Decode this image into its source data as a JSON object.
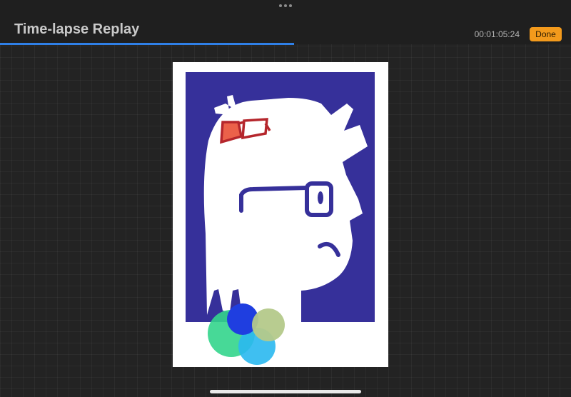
{
  "header": {
    "title": "Time-lapse Replay",
    "timestamp": "00:01:05:24",
    "done_label": "Done",
    "more_icon": "ellipsis-icon"
  },
  "replay": {
    "progress_percent": 51.5,
    "progress_color": "#2f80e8"
  },
  "colors": {
    "accent": "#f39a1c",
    "background": "#232323",
    "artwork_blue": "#36309a"
  }
}
